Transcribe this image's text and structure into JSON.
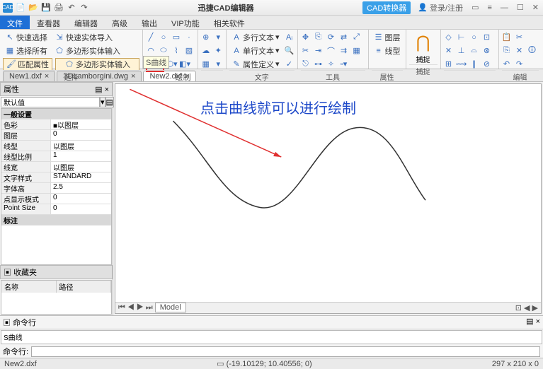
{
  "titlebar": {
    "app_title": "迅捷CAD编辑器",
    "cad_convert": "CAD转换器",
    "login": "登录/注册"
  },
  "menu": {
    "tabs": [
      "文件",
      "查看器",
      "编辑器",
      "高级",
      "输出",
      "VIP功能",
      "相关软件"
    ],
    "active": 0
  },
  "ribbon": {
    "sel": {
      "quick_select": "快速选择",
      "select_all": "选择所有",
      "match_prop": "匹配属性",
      "poly_input": "多边形实体输入",
      "quick_import": "快速实体导入",
      "label": "选择"
    },
    "draw": {
      "label": "绘制",
      "spline_tip": "S曲线"
    },
    "text": {
      "mtext": "多行文本",
      "stext": "单行文本",
      "attdef": "属性定义",
      "label": "文字"
    },
    "tools": {
      "label": "工具"
    },
    "layers": {
      "layer_btn": "图层",
      "linetype_btn": "线型",
      "label": "属性"
    },
    "snap": {
      "btn": "捕捉",
      "label": "捕捉"
    },
    "edit": {
      "label": "编辑"
    }
  },
  "doc_tabs": [
    "New1.dxf",
    "3DLamborgini.dwg",
    "New2.dxf"
  ],
  "props": {
    "title": "属性",
    "default_label": "默认值",
    "section": "一般设置",
    "rows": [
      {
        "k": "色彩",
        "v": "■以图层"
      },
      {
        "k": "图层",
        "v": "0"
      },
      {
        "k": "线型",
        "v": "以图层"
      },
      {
        "k": "线型比例",
        "v": "1"
      },
      {
        "k": "线宽",
        "v": "以图层"
      },
      {
        "k": "文字样式",
        "v": "STANDARD"
      },
      {
        "k": "字体高",
        "v": "2.5"
      },
      {
        "k": "点显示模式",
        "v": "0"
      },
      {
        "k": "Point Size",
        "v": "0"
      }
    ],
    "notes_title": "标注",
    "fav_title": "收藏夹",
    "fav_cols": [
      "名称",
      "路径"
    ]
  },
  "annotation": "点击曲线就可以进行绘制",
  "model_tab": "Model",
  "cmd": {
    "title": "命令行",
    "history": "S曲线",
    "prompt": "命令行:"
  },
  "status": {
    "file": "New2.dxf",
    "coords": "(-19.10129; 10.40556; 0)",
    "dims": "297 x 210 x 0"
  }
}
